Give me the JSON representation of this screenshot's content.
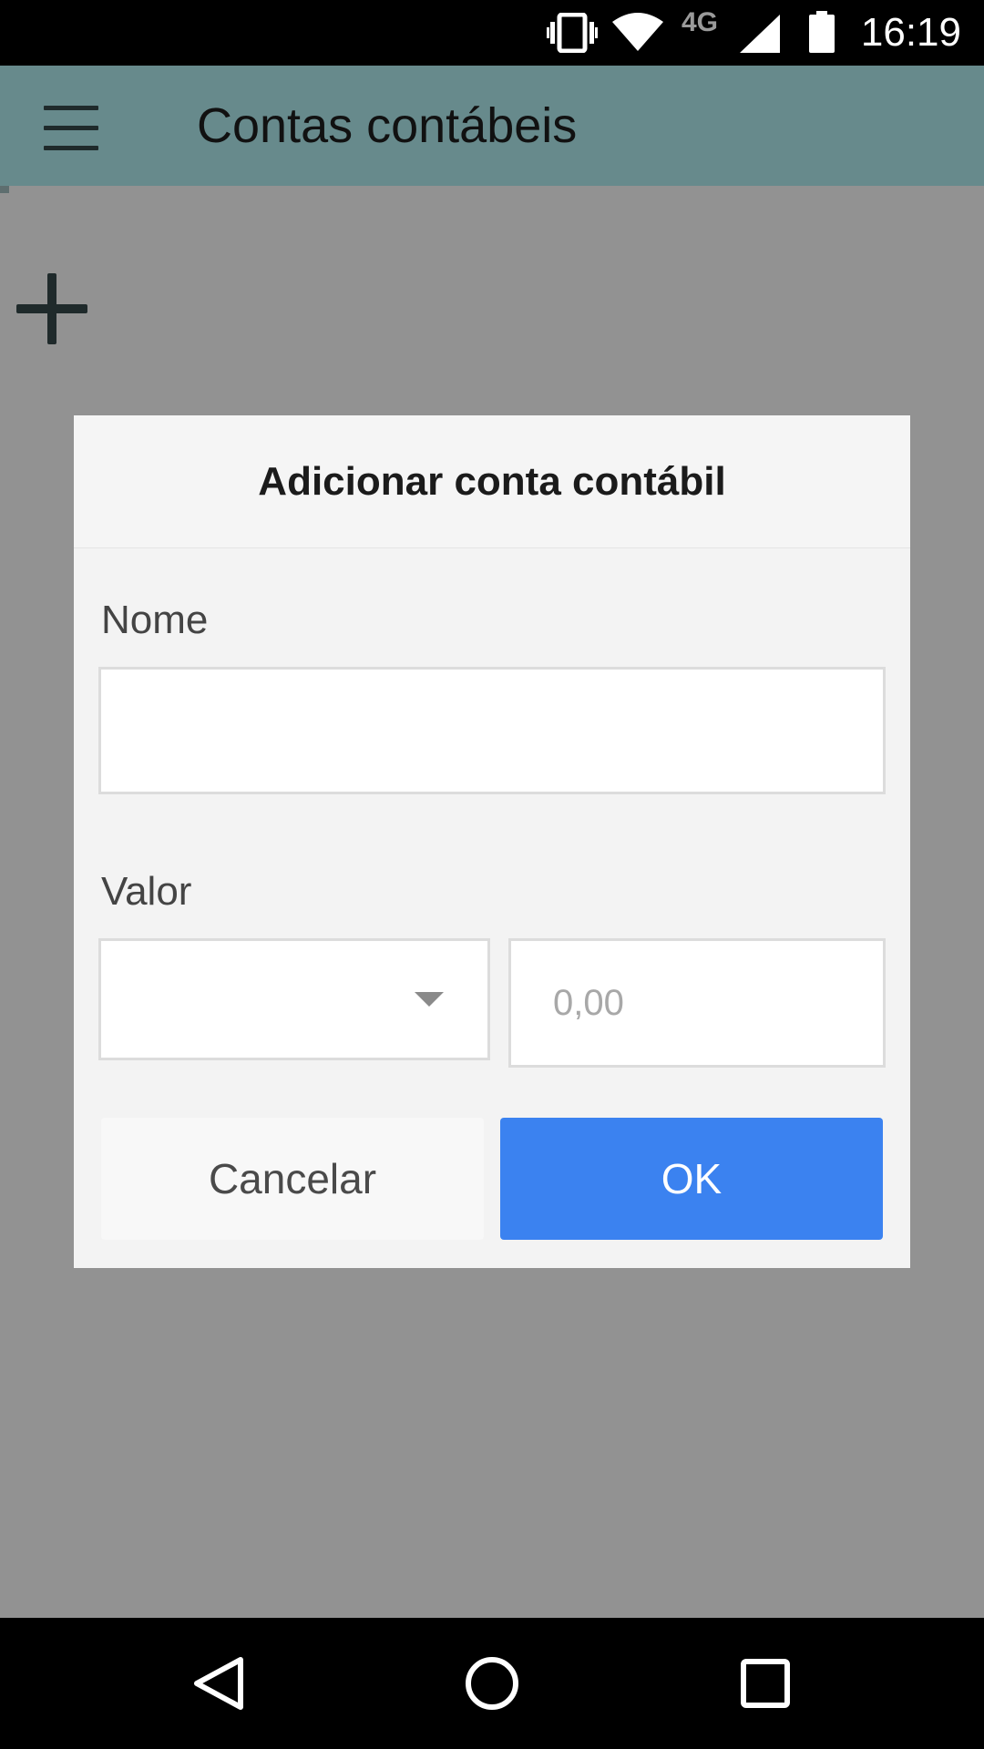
{
  "status_bar": {
    "time": "16:19",
    "network_label": "4G",
    "icons": [
      "vibrate-icon",
      "wifi-icon",
      "cell-signal-icon",
      "battery-icon"
    ]
  },
  "app_bar": {
    "title": "Contas contábeis",
    "menu_icon": "hamburger-menu-icon",
    "color": "#678a8c"
  },
  "main": {
    "add_icon": "plus-icon"
  },
  "dialog": {
    "title": "Adicionar conta contábil",
    "name_label": "Nome",
    "name_value": "",
    "value_label": "Valor",
    "currency_selected": "",
    "amount_value": "",
    "amount_placeholder": "0,00",
    "cancel_label": "Cancelar",
    "ok_label": "OK",
    "ok_color": "#3b82f0"
  },
  "nav_bar": {
    "icons": [
      "back-icon",
      "home-icon",
      "recents-icon"
    ]
  }
}
